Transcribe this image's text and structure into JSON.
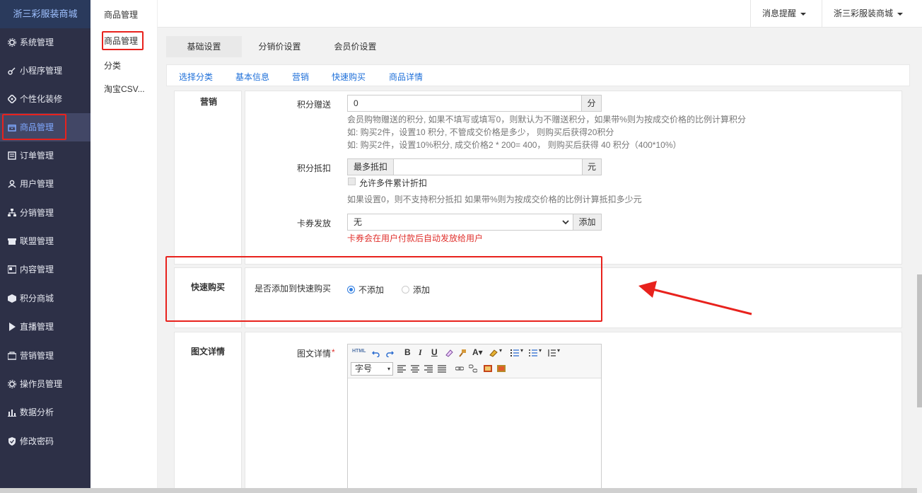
{
  "app": {
    "brand": "浙三彩服装商城"
  },
  "sidebar": {
    "items": [
      {
        "label": "系统管理",
        "icon": "gear-icon"
      },
      {
        "label": "小程序管理",
        "icon": "link-icon"
      },
      {
        "label": "个性化装修",
        "icon": "diamond-icon"
      },
      {
        "label": "商品管理",
        "icon": "box-icon"
      },
      {
        "label": "订单管理",
        "icon": "list-icon"
      },
      {
        "label": "用户管理",
        "icon": "user-icon"
      },
      {
        "label": "分销管理",
        "icon": "network-icon"
      },
      {
        "label": "联盟管理",
        "icon": "store-icon"
      },
      {
        "label": "内容管理",
        "icon": "content-icon"
      },
      {
        "label": "积分商城",
        "icon": "cube-icon"
      },
      {
        "label": "直播管理",
        "icon": "play-icon"
      },
      {
        "label": "营销管理",
        "icon": "marketing-icon"
      },
      {
        "label": "操作员管理",
        "icon": "gear-icon"
      },
      {
        "label": "数据分析",
        "icon": "bar-chart-icon"
      },
      {
        "label": "修改密码",
        "icon": "shield-icon"
      }
    ]
  },
  "submenu": {
    "title": "商品管理",
    "items": [
      "商品管理",
      "分类",
      "淘宝CSV..."
    ]
  },
  "topbar": {
    "notifications": "消息提醒",
    "store": "浙三彩服装商城"
  },
  "tabs": [
    "基础设置",
    "分销价设置",
    "会员价设置"
  ],
  "anchors": [
    "选择分类",
    "基本信息",
    "营销",
    "快速购买",
    "商品详情"
  ],
  "marketing": {
    "title": "营销",
    "points_gift_label": "积分赠送",
    "points_gift_value": "0",
    "points_gift_unit": "分",
    "points_gift_help": [
      "会员购物赠送的积分, 如果不填写或填写0，则默认为不赠送积分，如果带%则为按成交价格的比例计算积分",
      "如: 购买2件，设置10 积分, 不管成交价格是多少， 则购买后获得20积分",
      "如: 购买2件，设置10%积分, 成交价格2 * 200= 400， 则购买后获得 40 积分（400*10%）"
    ],
    "points_deduct_label": "积分抵扣",
    "points_deduct_prefix": "最多抵扣",
    "points_deduct_unit": "元",
    "allow_multi_label": "允许多件累计折扣",
    "points_deduct_help": "如果设置0，则不支持积分抵扣 如果带%则为按成交价格的比例计算抵扣多少元",
    "coupon_label": "卡券发放",
    "coupon_value": "无",
    "coupon_add": "添加",
    "coupon_help": "卡券会在用户付款后自动发放给用户"
  },
  "quickbuy": {
    "title": "快速购买",
    "label": "是否添加到快速购买",
    "options": [
      "不添加",
      "添加"
    ],
    "selected": 0
  },
  "detail": {
    "title": "图文详情",
    "label": "图文详情",
    "required": "*",
    "font_size": "字号"
  }
}
